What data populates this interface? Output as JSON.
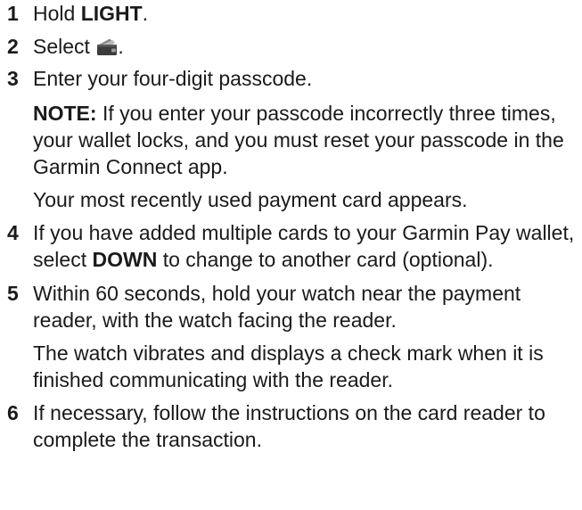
{
  "steps": [
    {
      "number": "1",
      "parts": {
        "before": "Hold ",
        "key": "LIGHT",
        "after": "."
      }
    },
    {
      "number": "2",
      "parts": {
        "before": "Select ",
        "icon": "wallet-icon",
        "after": "."
      }
    },
    {
      "number": "3",
      "text": "Enter your four-digit passcode.",
      "note": {
        "label": "NOTE:",
        "text": " If you enter your passcode incorrectly three times, your wallet locks, and you must reset your passcode in the Garmin Connect app."
      },
      "result": "Your most recently used payment card appears."
    },
    {
      "number": "4",
      "parts": {
        "before": "If you have added multiple cards to your Garmin Pay wallet, select ",
        "key": "DOWN",
        "after": " to change to another card (optional)."
      }
    },
    {
      "number": "5",
      "text": "Within 60 seconds, hold your watch near the payment reader, with the watch facing the reader.",
      "result": "The watch vibrates and displays a check mark when it is finished communicating with the reader."
    },
    {
      "number": "6",
      "text": "If necessary, follow the instructions on the card reader to complete the transaction."
    }
  ]
}
